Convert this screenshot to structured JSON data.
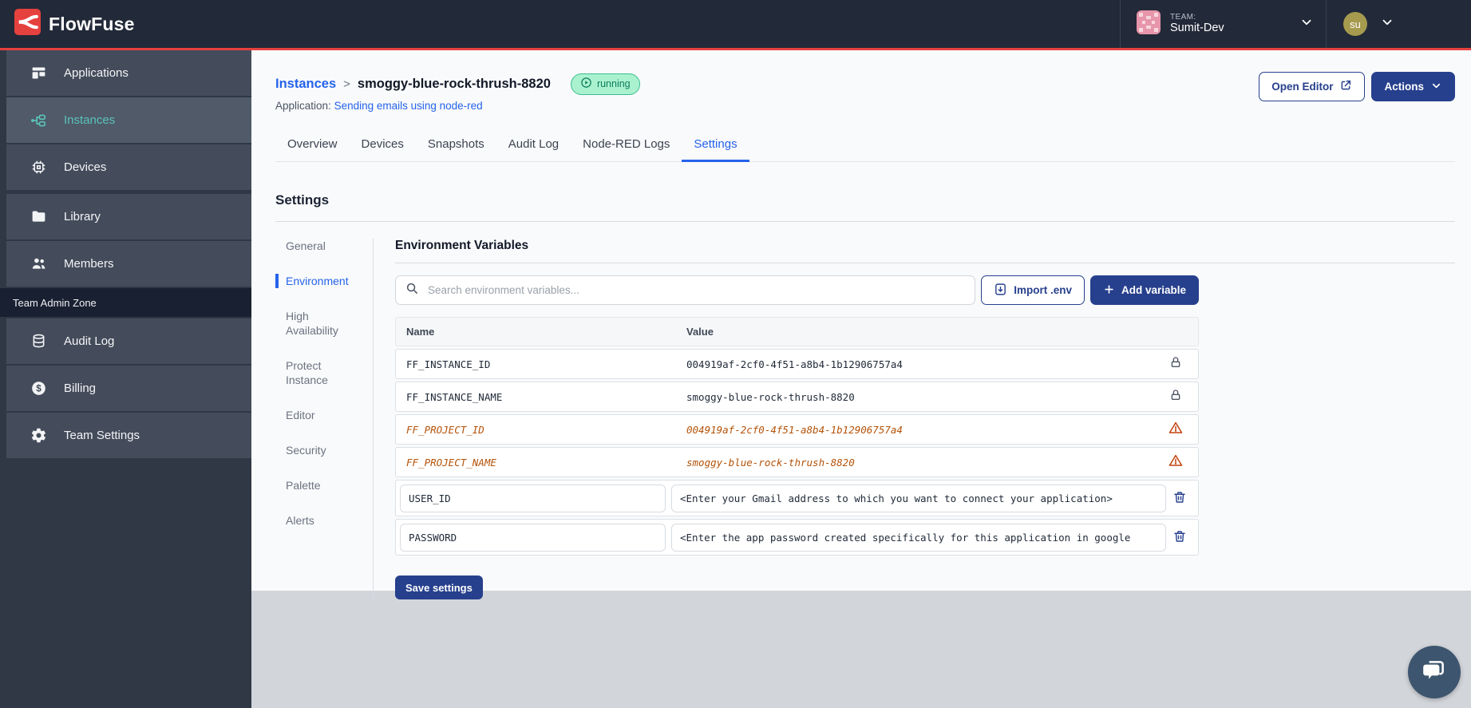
{
  "topbar": {
    "brand": "FlowFuse",
    "team_label": "TEAM:",
    "team_name": "Sumit-Dev",
    "user_initials": "su"
  },
  "sidebar": {
    "items": [
      {
        "label": "Applications"
      },
      {
        "label": "Instances",
        "active": true
      },
      {
        "label": "Devices"
      },
      {
        "label": "Library"
      },
      {
        "label": "Members"
      }
    ],
    "zone_label": "Team Admin Zone",
    "admin_items": [
      {
        "label": "Audit Log"
      },
      {
        "label": "Billing"
      },
      {
        "label": "Team Settings"
      }
    ]
  },
  "header": {
    "breadcrumb_root": "Instances",
    "breadcrumb_separator": ">",
    "instance_name": "smoggy-blue-rock-thrush-8820",
    "status_badge": "running",
    "application_label": "Application:",
    "application_link": "Sending emails using node-red",
    "open_editor_label": "Open Editor",
    "actions_label": "Actions"
  },
  "tabs": {
    "items": [
      "Overview",
      "Devices",
      "Snapshots",
      "Audit Log",
      "Node-RED Logs",
      "Settings"
    ],
    "active": "Settings"
  },
  "settings": {
    "title": "Settings",
    "nav": {
      "items": [
        "General",
        "Environment",
        "High Availability",
        "Protect Instance",
        "Editor",
        "Security",
        "Palette",
        "Alerts"
      ],
      "active": "Environment"
    },
    "panel_title": "Environment Variables",
    "search_placeholder": "Search environment variables...",
    "import_button": "Import .env",
    "add_button": "Add variable",
    "table": {
      "columns": [
        "Name",
        "Value"
      ],
      "rows": [
        {
          "name": "FF_INSTANCE_ID",
          "value": "004919af-2cf0-4f51-a8b4-1b12906757a4",
          "state": "locked"
        },
        {
          "name": "FF_INSTANCE_NAME",
          "value": "smoggy-blue-rock-thrush-8820",
          "state": "locked"
        },
        {
          "name": "FF_PROJECT_ID",
          "value": "004919af-2cf0-4f51-a8b4-1b12906757a4",
          "state": "deprecated"
        },
        {
          "name": "FF_PROJECT_NAME",
          "value": "smoggy-blue-rock-thrush-8820",
          "state": "deprecated"
        },
        {
          "name": "USER_ID",
          "value": "<Enter your Gmail address to which you want to connect your application>",
          "state": "editable"
        },
        {
          "name": "PASSWORD",
          "value": "<Enter the app password created specifically for this application in google",
          "state": "editable"
        }
      ]
    },
    "save_button": "Save settings"
  },
  "icons": [
    "flowfuse-logo",
    "chevron-down-icon",
    "applications-icon",
    "instances-icon",
    "devices-icon",
    "library-icon",
    "members-icon",
    "audit-log-icon",
    "billing-icon",
    "gear-icon",
    "play-circle-icon",
    "external-link-icon",
    "search-icon",
    "import-env-icon",
    "plus-icon",
    "lock-icon",
    "warning-icon",
    "trash-icon",
    "chat-icon"
  ],
  "colors": {
    "topbar_bg": "#222938",
    "accent_red": "#e5413e",
    "sidebar_bg": "#313845",
    "sidebar_item": "#444c5b",
    "teal_active": "#5bc4b8",
    "link_blue": "#2563eb",
    "navy_button": "#27408d",
    "badge_bg": "#aaf2cf",
    "badge_text": "#0b7c5c",
    "deprecated_orange": "#b45309",
    "footer_gray": "#d2d5da"
  }
}
